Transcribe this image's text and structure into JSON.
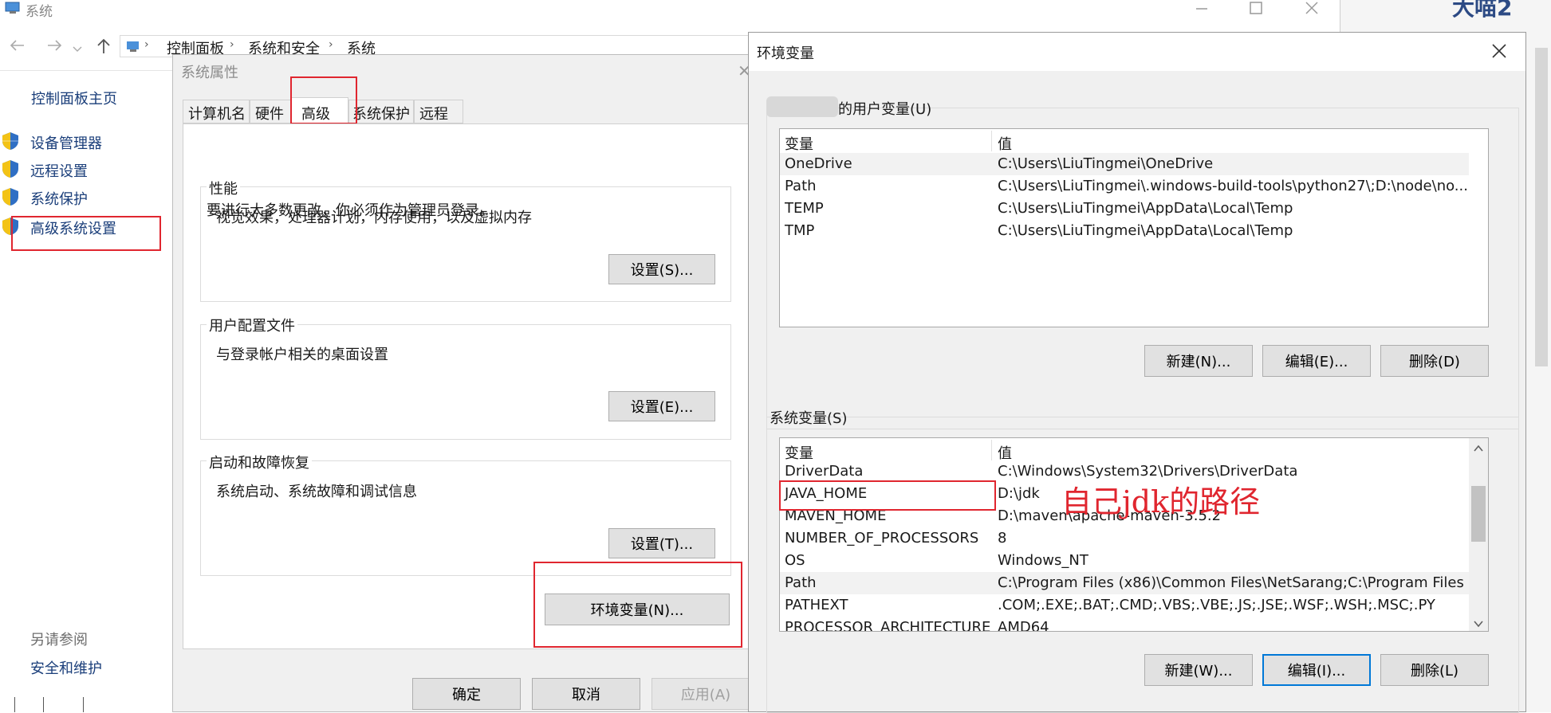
{
  "bg_window": {
    "title": "系统",
    "breadcrumb": [
      "控制面板",
      "系统和安全",
      "系统"
    ],
    "sidebar_home": "控制面板主页",
    "sidebar_items": [
      "设备管理器",
      "远程设置",
      "系统保护",
      "高级系统设置"
    ],
    "see_also_title": "另请参阅",
    "see_also_item": "安全和维护",
    "corner_text": "大喵2"
  },
  "sysprops": {
    "title": "系统属性",
    "tabs": [
      "计算机名",
      "硬件",
      "高级",
      "系统保护",
      "远程"
    ],
    "active_tab": "高级",
    "admin_note": "要进行大多数更改，你必须作为管理员登录。",
    "perf_title": "性能",
    "perf_desc": "视觉效果，处理器计划，内存使用，以及虚拟内存",
    "perf_button": "设置(S)...",
    "profile_title": "用户配置文件",
    "profile_desc": "与登录帐户相关的桌面设置",
    "profile_button": "设置(E)...",
    "startup_title": "启动和故障恢复",
    "startup_desc": "系统启动、系统故障和调试信息",
    "startup_button": "设置(T)...",
    "env_button": "环境变量(N)...",
    "ok": "确定",
    "cancel": "取消",
    "apply": "应用(A)"
  },
  "envvars": {
    "title": "环境变量",
    "user_group_title": "的用户变量(U)",
    "col_var": "变量",
    "col_val": "值",
    "user_rows": [
      {
        "name": "OneDrive",
        "value": "C:\\Users\\LiuTingmei\\OneDrive"
      },
      {
        "name": "Path",
        "value": "C:\\Users\\LiuTingmei\\.windows-build-tools\\python27\\;D:\\node\\no..."
      },
      {
        "name": "TEMP",
        "value": "C:\\Users\\LiuTingmei\\AppData\\Local\\Temp"
      },
      {
        "name": "TMP",
        "value": "C:\\Users\\LiuTingmei\\AppData\\Local\\Temp"
      }
    ],
    "user_new": "新建(N)...",
    "user_edit": "编辑(E)...",
    "user_delete": "删除(D)",
    "sys_group_title": "系统变量(S)",
    "sys_rows": [
      {
        "name": "DriverData",
        "value": "C:\\Windows\\System32\\Drivers\\DriverData"
      },
      {
        "name": "JAVA_HOME",
        "value": "D:\\jdk"
      },
      {
        "name": "MAVEN_HOME",
        "value": "D:\\maven\\apache-maven-3.5.2"
      },
      {
        "name": "NUMBER_OF_PROCESSORS",
        "value": "8"
      },
      {
        "name": "OS",
        "value": "Windows_NT"
      },
      {
        "name": "Path",
        "value": "C:\\Program Files (x86)\\Common Files\\NetSarang;C:\\Program Files ..."
      },
      {
        "name": "PATHEXT",
        "value": ".COM;.EXE;.BAT;.CMD;.VBS;.VBE;.JS;.JSE;.WSF;.WSH;.MSC;.PY"
      },
      {
        "name": "PROCESSOR_ARCHITECTURE",
        "value": "AMD64"
      }
    ],
    "sys_new": "新建(W)...",
    "sys_edit": "编辑(I)...",
    "sys_delete": "删除(L)",
    "annotation": "自己jdk的路径"
  }
}
